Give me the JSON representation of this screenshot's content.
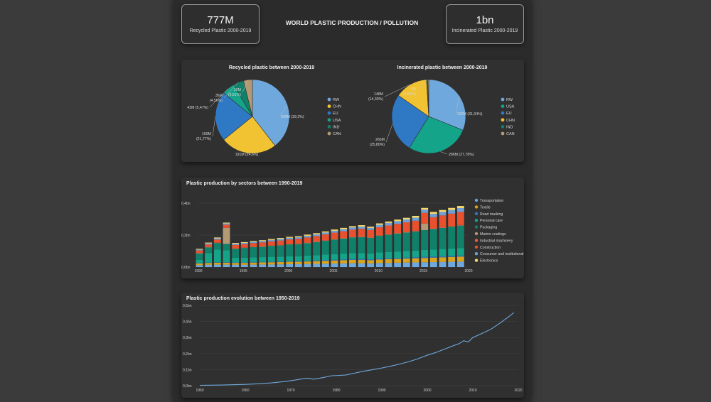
{
  "header": {
    "title": "WORLD PLASTIC PRODUCTION / POLLUTION",
    "kpi_left": {
      "value": "777M",
      "label": "Recycled Plastic 2000-2019"
    },
    "kpi_right": {
      "value": "1bn",
      "label": "Incinerated Plastic 2000-2019"
    }
  },
  "colors": {
    "RW": "#6fa8dc",
    "CHN": "#f1c232",
    "EU": "#2f78c4",
    "USA": "#14a489",
    "IND": "#12806a",
    "CAN": "#b39a74",
    "Transportation": "#6fa8dc",
    "Textile": "#d9a41c",
    "Road marking": "#2f78c4",
    "Personal care": "#14a489",
    "Packaging": "#10806a",
    "Marine coatings": "#b39a74",
    "Industrial machinery": "#e8603c",
    "Construction": "#e8502e",
    "Consumer and institutional": "#6f9fd6",
    "Electronics": "#f6da6b",
    "line": "#6fa8dc"
  },
  "chart_data": [
    {
      "type": "pie",
      "title": "Recycled plastic between 2000-2019",
      "slices": [
        {
          "name": "RW",
          "value": 306,
          "label": "306M (39,3%)"
        },
        {
          "name": "CHN",
          "value": 191,
          "label": "191M (24,6%)"
        },
        {
          "name": "EU",
          "value": 169,
          "label": "169M (21,77%)"
        },
        {
          "name": "USA",
          "value": 43,
          "label": "43M (5,47%)"
        },
        {
          "name": "IND",
          "value": 36,
          "label": "36M (4,56%)"
        },
        {
          "name": "CAN",
          "value": 30,
          "label": "30M (3,81%)"
        }
      ],
      "legend": [
        "RW",
        "CHN",
        "EU",
        "USA",
        "IND",
        "CAN"
      ]
    },
    {
      "type": "pie",
      "title": "Incinerated plastic between 2000-2019",
      "slices": [
        {
          "name": "RW",
          "value": 320,
          "label": "320M (31,04%)"
        },
        {
          "name": "USA",
          "value": 286,
          "label": "286M (27,78%)"
        },
        {
          "name": "EU",
          "value": 266,
          "label": "266M (25,80%)"
        },
        {
          "name": "CHN",
          "value": 148,
          "label": "148M (14,30%)"
        },
        {
          "name": "IND",
          "value": 6,
          "label": "6M (0,61%)"
        },
        {
          "name": "CAN",
          "value": 4,
          "label": ""
        }
      ],
      "legend": [
        "RW",
        "USA",
        "EU",
        "CHN",
        "IND",
        "CAN"
      ]
    },
    {
      "type": "bar",
      "stacked": true,
      "title": "Plastic production by sectors between 1990-2019",
      "x": [
        1990,
        1991,
        1992,
        1993,
        1994,
        1995,
        1996,
        1997,
        1998,
        1999,
        2000,
        2001,
        2002,
        2003,
        2004,
        2005,
        2006,
        2007,
        2008,
        2009,
        2010,
        2011,
        2012,
        2013,
        2014,
        2015,
        2016,
        2017,
        2018,
        2019
      ],
      "xticks": [
        "1990",
        "1995",
        "2000",
        "2005",
        "2010",
        "2015",
        "2020"
      ],
      "xlim": [
        1990,
        2020
      ],
      "ylim": [
        0,
        0.4
      ],
      "yticks": [
        "0,0bn",
        "0,2bn",
        "0,4bn"
      ],
      "legend": [
        "Transportation",
        "Textile",
        "Road marking",
        "Personal care",
        "Packaging",
        "Marine coatings",
        "Industrial machinery",
        "Construction",
        "Consumer and institutional",
        "Electronics"
      ],
      "series": [
        {
          "name": "Transportation",
          "values": [
            0.012,
            0.014,
            0.015,
            0.015,
            0.014,
            0.014,
            0.015,
            0.016,
            0.016,
            0.017,
            0.018,
            0.018,
            0.019,
            0.02,
            0.021,
            0.022,
            0.023,
            0.024,
            0.024,
            0.023,
            0.025,
            0.026,
            0.027,
            0.028,
            0.029,
            0.03,
            0.031,
            0.032,
            0.033,
            0.034
          ]
        },
        {
          "name": "Textile",
          "values": [
            0.01,
            0.011,
            0.012,
            0.012,
            0.012,
            0.012,
            0.013,
            0.013,
            0.014,
            0.014,
            0.015,
            0.015,
            0.016,
            0.017,
            0.018,
            0.019,
            0.02,
            0.021,
            0.021,
            0.02,
            0.022,
            0.023,
            0.024,
            0.025,
            0.026,
            0.027,
            0.028,
            0.029,
            0.03,
            0.031
          ]
        },
        {
          "name": "Road marking",
          "values": [
            0.003,
            0.003,
            0.003,
            0.003,
            0.003,
            0.003,
            0.003,
            0.003,
            0.004,
            0.004,
            0.004,
            0.004,
            0.004,
            0.004,
            0.005,
            0.005,
            0.005,
            0.005,
            0.005,
            0.005,
            0.006,
            0.006,
            0.006,
            0.006,
            0.006,
            0.007,
            0.007,
            0.007,
            0.007,
            0.007
          ]
        },
        {
          "name": "Personal care",
          "values": [
            0.02,
            0.06,
            0.08,
            0.075,
            0.03,
            0.03,
            0.03,
            0.03,
            0.03,
            0.03,
            0.031,
            0.031,
            0.032,
            0.033,
            0.034,
            0.035,
            0.036,
            0.037,
            0.037,
            0.036,
            0.038,
            0.039,
            0.04,
            0.041,
            0.042,
            0.043,
            0.044,
            0.045,
            0.046,
            0.047
          ]
        },
        {
          "name": "Packaging",
          "values": [
            0.04,
            0.035,
            0.04,
            0.04,
            0.055,
            0.06,
            0.063,
            0.065,
            0.068,
            0.07,
            0.073,
            0.075,
            0.078,
            0.082,
            0.086,
            0.09,
            0.094,
            0.098,
            0.1,
            0.098,
            0.104,
            0.108,
            0.112,
            0.116,
            0.12,
            0.124,
            0.128,
            0.132,
            0.136,
            0.14
          ]
        },
        {
          "name": "Marine coatings",
          "values": [
            0.002,
            0.002,
            0.002,
            0.1,
            0.002,
            0.002,
            0.002,
            0.002,
            0.002,
            0.002,
            0.002,
            0.002,
            0.002,
            0.002,
            0.002,
            0.002,
            0.002,
            0.002,
            0.002,
            0.002,
            0.002,
            0.002,
            0.002,
            0.002,
            0.002,
            0.04,
            0.002,
            0.002,
            0.002,
            0.002
          ]
        },
        {
          "name": "Industrial machinery",
          "values": [
            0.002,
            0.002,
            0.002,
            0.002,
            0.002,
            0.002,
            0.002,
            0.002,
            0.002,
            0.002,
            0.002,
            0.002,
            0.002,
            0.002,
            0.002,
            0.002,
            0.002,
            0.002,
            0.002,
            0.002,
            0.002,
            0.002,
            0.002,
            0.002,
            0.002,
            0.002,
            0.002,
            0.002,
            0.002,
            0.002
          ]
        },
        {
          "name": "Construction",
          "values": [
            0.015,
            0.015,
            0.018,
            0.018,
            0.02,
            0.02,
            0.022,
            0.023,
            0.025,
            0.027,
            0.028,
            0.03,
            0.032,
            0.034,
            0.036,
            0.04,
            0.042,
            0.045,
            0.048,
            0.046,
            0.05,
            0.054,
            0.057,
            0.06,
            0.063,
            0.066,
            0.07,
            0.074,
            0.078,
            0.082
          ]
        },
        {
          "name": "Consumer and institutional",
          "values": [
            0.006,
            0.007,
            0.008,
            0.008,
            0.008,
            0.008,
            0.008,
            0.009,
            0.009,
            0.01,
            0.01,
            0.01,
            0.011,
            0.011,
            0.012,
            0.012,
            0.013,
            0.014,
            0.014,
            0.013,
            0.015,
            0.016,
            0.017,
            0.018,
            0.019,
            0.02,
            0.021,
            0.022,
            0.023,
            0.024
          ]
        },
        {
          "name": "Electronics",
          "values": [
            0.004,
            0.004,
            0.005,
            0.005,
            0.005,
            0.005,
            0.005,
            0.005,
            0.006,
            0.006,
            0.006,
            0.006,
            0.007,
            0.007,
            0.007,
            0.008,
            0.008,
            0.008,
            0.009,
            0.008,
            0.009,
            0.009,
            0.01,
            0.01,
            0.011,
            0.011,
            0.012,
            0.012,
            0.013,
            0.013
          ]
        }
      ]
    },
    {
      "type": "line",
      "title": "Plastic production evolution between 1950-2019",
      "xlim": [
        1950,
        2020
      ],
      "ylim": [
        0,
        0.5
      ],
      "xticks": [
        "1950",
        "1960",
        "1970",
        "1980",
        "1990",
        "2000",
        "2010",
        "2020"
      ],
      "yticks": [
        "0,0bn",
        "0,1bn",
        "0,2bn",
        "0,3bn",
        "0,4bn",
        "0,5bn"
      ],
      "x": [
        1950,
        1955,
        1960,
        1963,
        1966,
        1969,
        1971,
        1973,
        1974,
        1975,
        1977,
        1979,
        1980,
        1982,
        1984,
        1986,
        1988,
        1990,
        1992,
        1994,
        1996,
        1998,
        2000,
        2002,
        2004,
        2006,
        2007,
        2008,
        2009,
        2010,
        2012,
        2014,
        2016,
        2018,
        2019
      ],
      "y": [
        0.002,
        0.004,
        0.008,
        0.012,
        0.018,
        0.027,
        0.035,
        0.045,
        0.046,
        0.04,
        0.05,
        0.062,
        0.063,
        0.066,
        0.078,
        0.09,
        0.1,
        0.11,
        0.122,
        0.135,
        0.15,
        0.168,
        0.19,
        0.208,
        0.23,
        0.252,
        0.262,
        0.28,
        0.272,
        0.3,
        0.325,
        0.352,
        0.39,
        0.432,
        0.455
      ]
    }
  ]
}
